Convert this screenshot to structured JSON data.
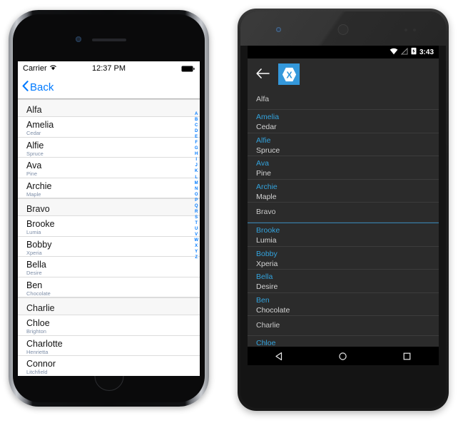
{
  "ios": {
    "status": {
      "carrier": "Carrier",
      "wifi_icon": "wifi-icon",
      "time": "12:37 PM",
      "battery_icon": "battery-icon"
    },
    "navbar": {
      "back_label": "Back",
      "back_icon": "chevron-left-icon"
    },
    "rows": [
      {
        "type": "header",
        "title": "Alfa"
      },
      {
        "type": "cell",
        "name": "Amelia",
        "sub": "Cedar"
      },
      {
        "type": "cell",
        "name": "Alfie",
        "sub": "Spruce"
      },
      {
        "type": "cell",
        "name": "Ava",
        "sub": "Pine"
      },
      {
        "type": "cell",
        "name": "Archie",
        "sub": "Maple"
      },
      {
        "type": "header",
        "title": "Bravo"
      },
      {
        "type": "cell",
        "name": "Brooke",
        "sub": "Lumia"
      },
      {
        "type": "cell",
        "name": "Bobby",
        "sub": "Xperia"
      },
      {
        "type": "cell",
        "name": "Bella",
        "sub": "Desire"
      },
      {
        "type": "cell",
        "name": "Ben",
        "sub": "Chocolate"
      },
      {
        "type": "header",
        "title": "Charlie"
      },
      {
        "type": "cell",
        "name": "Chloe",
        "sub": "Brighton"
      },
      {
        "type": "cell",
        "name": "Charlotte",
        "sub": "Henrietta"
      },
      {
        "type": "cell",
        "name": "Connor",
        "sub": "Litchfield"
      }
    ],
    "section_index": [
      "A",
      "B",
      "C",
      "D",
      "E",
      "F",
      "G",
      "H",
      "I",
      "J",
      "K",
      "L",
      "M",
      "N",
      "O",
      "P",
      "Q",
      "R",
      "S",
      "T",
      "U",
      "V",
      "W",
      "X",
      "Y",
      "Z"
    ]
  },
  "android": {
    "status": {
      "wifi_icon": "wifi-icon",
      "signal_off_icon": "signal-off-icon",
      "battery_icon": "battery-charging-icon",
      "time": "3:43"
    },
    "toolbar": {
      "back_icon": "arrow-left-icon",
      "logo_icon": "xamarin-logo-icon",
      "logo_letter": "X"
    },
    "rows": [
      {
        "type": "header",
        "title": "Alfa"
      },
      {
        "type": "cell",
        "name": "Amelia",
        "sub": "Cedar"
      },
      {
        "type": "cell",
        "name": "Alfie",
        "sub": "Spruce"
      },
      {
        "type": "cell",
        "name": "Ava",
        "sub": "Pine"
      },
      {
        "type": "cell",
        "name": "Archie",
        "sub": "Maple"
      },
      {
        "type": "header",
        "title": "Bravo"
      },
      {
        "type": "cell",
        "name": "Brooke",
        "sub": "Lumia"
      },
      {
        "type": "cell",
        "name": "Bobby",
        "sub": "Xperia"
      },
      {
        "type": "cell",
        "name": "Bella",
        "sub": "Desire"
      },
      {
        "type": "cell",
        "name": "Ben",
        "sub": "Chocolate"
      },
      {
        "type": "header",
        "title": "Charlie"
      },
      {
        "type": "cell",
        "name": "Chloe",
        "sub": ""
      }
    ],
    "navbar": {
      "back_icon": "nav-back-triangle-icon",
      "home_icon": "nav-home-circle-icon",
      "recents_icon": "nav-recents-square-icon"
    }
  },
  "colors": {
    "ios_accent": "#007aff",
    "ios_subtitle": "#7f8fa8",
    "android_accent": "#33a3dd",
    "xamarin_blue": "#3498db",
    "android_bg": "#2b2b2b"
  }
}
